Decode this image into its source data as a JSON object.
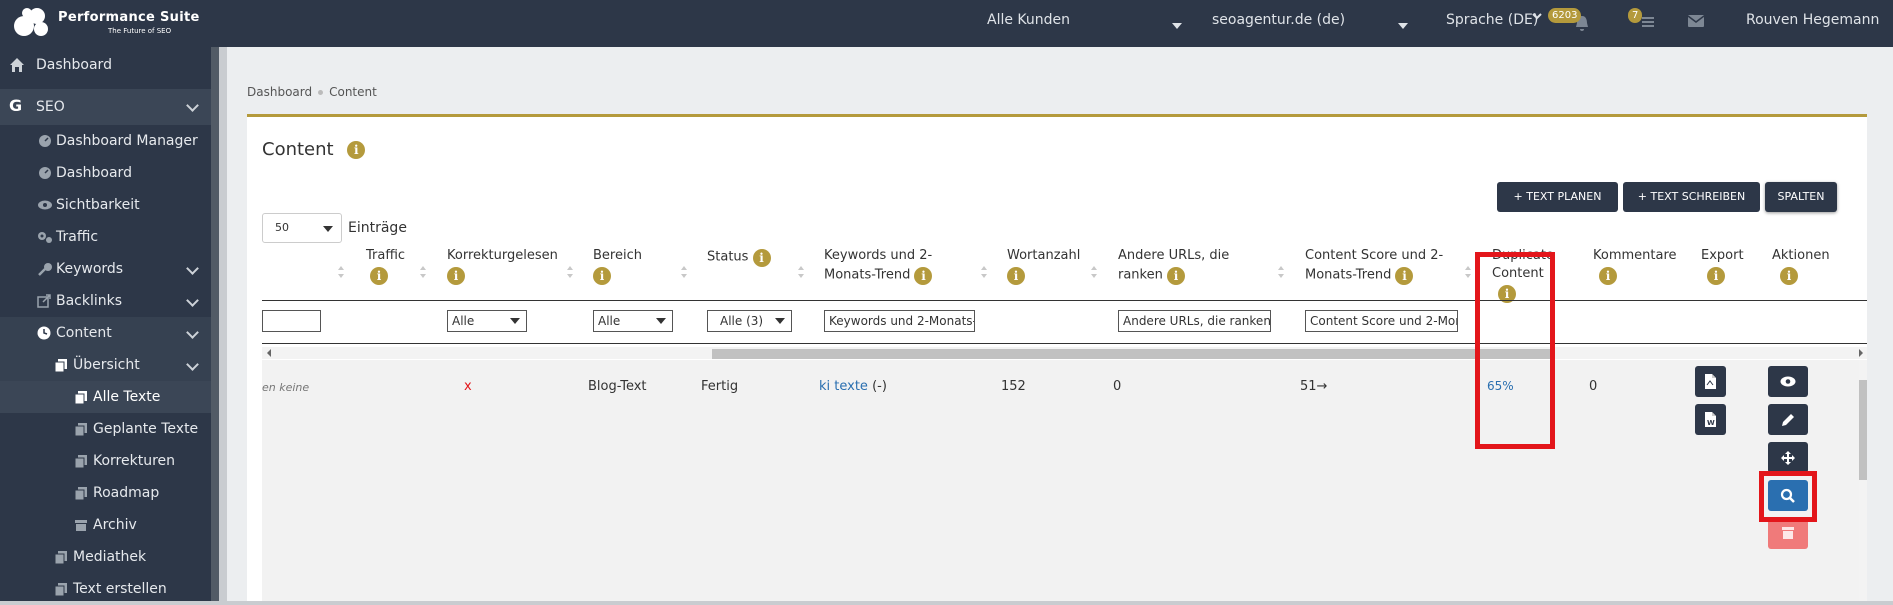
{
  "app": {
    "logo_title": "Performance Suite",
    "logo_subtitle": "The Future of SEO"
  },
  "topbar": {
    "customer_select": "Alle Kunden",
    "project_select": "seoagentur.de (de)",
    "language": "Sprache (DE)",
    "notif_badge": "6203",
    "tasks_badge": "7",
    "user_name": "Rouven Hegemann"
  },
  "sidebar": {
    "items": [
      {
        "label": "Dashboard",
        "icon": "home-icon"
      },
      {
        "label": "SEO",
        "icon": "google-icon"
      },
      {
        "label": "Dashboard Manager",
        "icon": "dashboard-icon"
      },
      {
        "label": "Dashboard",
        "icon": "dashboard-icon"
      },
      {
        "label": "Sichtbarkeit",
        "icon": "eye-icon"
      },
      {
        "label": "Traffic",
        "icon": "gears-icon"
      },
      {
        "label": "Keywords",
        "icon": "key-icon"
      },
      {
        "label": "Backlinks",
        "icon": "external-link-icon"
      },
      {
        "label": "Content",
        "icon": "clock-icon"
      },
      {
        "label": "Übersicht",
        "icon": "copy-icon"
      },
      {
        "label": "Alle Texte",
        "icon": "copy-icon"
      },
      {
        "label": "Geplante Texte",
        "icon": "copy-icon"
      },
      {
        "label": "Korrekturen",
        "icon": "copy-icon"
      },
      {
        "label": "Roadmap",
        "icon": "copy-icon"
      },
      {
        "label": "Archiv",
        "icon": "archive-icon"
      },
      {
        "label": "Mediathek",
        "icon": "copy-icon"
      },
      {
        "label": "Text erstellen",
        "icon": "copy-icon"
      }
    ]
  },
  "breadcrumb": {
    "home": "Dashboard",
    "current": "Content"
  },
  "page": {
    "title": "Content",
    "btn_plan": "TEXT PLANEN",
    "btn_write": "TEXT SCHREIBEN",
    "btn_columns": "SPALTEN",
    "entries_value": "50",
    "entries_label": "Einträge"
  },
  "table": {
    "headers": {
      "traffic": "Traffic",
      "proofread": "Korrekturgelesen",
      "area": "Bereich",
      "status": "Status",
      "keywords_l1": "Keywords und 2-",
      "keywords_l2": "Monats-Trend",
      "wordcount": "Wortanzahl",
      "urls_l1": "Andere URLs, die",
      "urls_l2": "ranken",
      "score_l1": "Content Score und 2-",
      "score_l2": "Monats-Trend",
      "dup_l1": "Duplicate",
      "dup_l2": "Content",
      "comments": "Kommentare",
      "export": "Export",
      "actions": "Aktionen"
    },
    "filters": {
      "proofread": "Alle",
      "area": "Alle",
      "status": "Alle (3)",
      "keywords_placeholder": "Keywords und 2-Monats-",
      "urls_placeholder": "Andere URLs, die ranken",
      "score_placeholder": "Content Score und 2-Mon"
    },
    "row": {
      "truncated": "en keine",
      "proofread": "x",
      "area": "Blog-Text",
      "status": "Fertig",
      "keyword": "ki texte",
      "keyword_trend": "(-)",
      "wordcount": "152",
      "other_urls": "0",
      "score": "51",
      "score_trend": "→",
      "duplicate": "65%",
      "comments": "0"
    }
  },
  "colors": {
    "sidebar_bg": "#2d3748",
    "accent_gold": "#b49a3c",
    "link_blue": "#2a6fb0",
    "highlight_red": "#e3161b",
    "search_blue": "#2a6fb0"
  }
}
